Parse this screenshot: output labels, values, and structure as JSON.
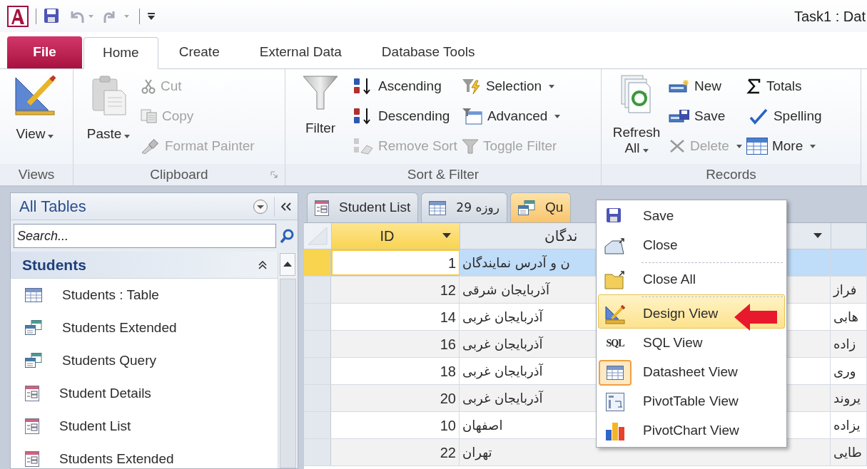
{
  "window": {
    "title": "Task1 : Dat"
  },
  "ribbon_tabs": [
    {
      "label": "File",
      "kind": "file",
      "selected": false
    },
    {
      "label": "Home",
      "kind": "tab",
      "selected": true
    },
    {
      "label": "Create",
      "kind": "tab",
      "selected": false
    },
    {
      "label": "External Data",
      "kind": "tab",
      "selected": false
    },
    {
      "label": "Database Tools",
      "kind": "tab",
      "selected": false
    }
  ],
  "ribbon_groups": [
    {
      "label": "Views",
      "dialog_launcher": false,
      "columns": [
        [
          {
            "label": "View",
            "kind": "large",
            "dropdown": true,
            "disabled": false
          }
        ]
      ]
    },
    {
      "label": "Clipboard",
      "dialog_launcher": true,
      "columns": [
        [
          {
            "label": "Paste",
            "kind": "large",
            "dropdown": true,
            "disabled": false
          }
        ],
        [
          {
            "label": "Cut",
            "kind": "small",
            "dropdown": false,
            "disabled": true
          },
          {
            "label": "Copy",
            "kind": "small",
            "dropdown": false,
            "disabled": true
          },
          {
            "label": "Format Painter",
            "kind": "small",
            "dropdown": false,
            "disabled": true
          }
        ]
      ]
    },
    {
      "label": "Sort & Filter",
      "dialog_launcher": false,
      "columns": [
        [
          {
            "label": "Filter",
            "kind": "large",
            "dropdown": false,
            "disabled": false
          }
        ],
        [
          {
            "label": "Ascending",
            "kind": "small",
            "dropdown": false,
            "disabled": false
          },
          {
            "label": "Descending",
            "kind": "small",
            "dropdown": false,
            "disabled": false
          },
          {
            "label": "Remove Sort",
            "kind": "small",
            "dropdown": false,
            "disabled": true
          }
        ],
        [
          {
            "label": "Selection",
            "kind": "small",
            "dropdown": true,
            "disabled": false
          },
          {
            "label": "Advanced",
            "kind": "small",
            "dropdown": true,
            "disabled": false
          },
          {
            "label": "Toggle Filter",
            "kind": "small",
            "dropdown": false,
            "disabled": true
          }
        ]
      ]
    },
    {
      "label": "Records",
      "dialog_launcher": false,
      "columns": [
        [
          {
            "label": "Refresh All",
            "kind": "large",
            "dropdown": true,
            "disabled": false
          }
        ],
        [
          {
            "label": "New",
            "kind": "small",
            "dropdown": false,
            "disabled": false
          },
          {
            "label": "Save",
            "kind": "small",
            "dropdown": false,
            "disabled": false
          },
          {
            "label": "Delete",
            "kind": "small",
            "dropdown": true,
            "disabled": true
          }
        ],
        [
          {
            "label": "Totals",
            "kind": "small",
            "dropdown": false,
            "disabled": false
          },
          {
            "label": "Spelling",
            "kind": "small",
            "dropdown": false,
            "disabled": false
          },
          {
            "label": "More",
            "kind": "small",
            "dropdown": true,
            "disabled": false
          }
        ]
      ]
    }
  ],
  "navigation_pane": {
    "title": "All Tables",
    "search": {
      "placeholder": "Search..."
    },
    "group": {
      "label": "Students",
      "expanded": true
    },
    "items": [
      {
        "label": "Students : Table",
        "kind": "table"
      },
      {
        "label": "Students Extended",
        "kind": "query"
      },
      {
        "label": "Students Query",
        "kind": "query"
      },
      {
        "label": "Student Details",
        "kind": "form"
      },
      {
        "label": "Student List",
        "kind": "form"
      },
      {
        "label": "Students Extended",
        "kind": "form"
      }
    ]
  },
  "document_tabs": [
    {
      "label": "Student List",
      "kind": "form",
      "selected": false
    },
    {
      "label": "روزه 29",
      "kind": "table",
      "selected": false
    },
    {
      "label": "Qu",
      "kind": "query",
      "selected": true
    }
  ],
  "datasheet": {
    "columns": [
      {
        "label": "ID",
        "selected": true,
        "filter_button": true
      },
      {
        "label": "ندگان",
        "selected": false,
        "filter_button": true
      },
      {
        "selected": false,
        "filter_button": false
      }
    ],
    "rows": [
      {
        "selected": true,
        "cells": [
          "1",
          "ن و آدرس نمایندگان"
        ]
      },
      {
        "selected": false,
        "cells": [
          "12",
          "آذربایجان شرقی",
          "فراز"
        ]
      },
      {
        "selected": false,
        "cells": [
          "14",
          "آذربایجان غربی",
          "هابی"
        ]
      },
      {
        "selected": false,
        "cells": [
          "16",
          "آذربایجان غربی",
          "زاده"
        ]
      },
      {
        "selected": false,
        "cells": [
          "18",
          "آذربایجان غربی",
          "وری"
        ]
      },
      {
        "selected": false,
        "cells": [
          "20",
          "آذربایجان غربی",
          "یروند"
        ]
      },
      {
        "selected": false,
        "cells": [
          "10",
          "اصفهان",
          "یزاده"
        ]
      },
      {
        "selected": false,
        "cells": [
          "22",
          "تهران",
          "طایی"
        ]
      }
    ]
  },
  "context_menu": {
    "items": [
      {
        "label": "Save",
        "separator_before": false,
        "selected": false,
        "checked": false
      },
      {
        "label": "Close",
        "separator_before": false,
        "selected": false,
        "checked": false
      },
      {
        "label": "Close All",
        "separator_before": true,
        "selected": false,
        "checked": false
      },
      {
        "label": "Design View",
        "separator_before": true,
        "selected": true,
        "checked": false
      },
      {
        "label": "SQL View",
        "icon_label": "SQL",
        "separator_before": false,
        "selected": false,
        "checked": false
      },
      {
        "label": "Datasheet View",
        "separator_before": false,
        "selected": false,
        "checked": true
      },
      {
        "label": "PivotTable View",
        "separator_before": false,
        "selected": false,
        "checked": false
      },
      {
        "label": "PivotChart View",
        "separator_before": false,
        "selected": false,
        "checked": false
      }
    ]
  }
}
